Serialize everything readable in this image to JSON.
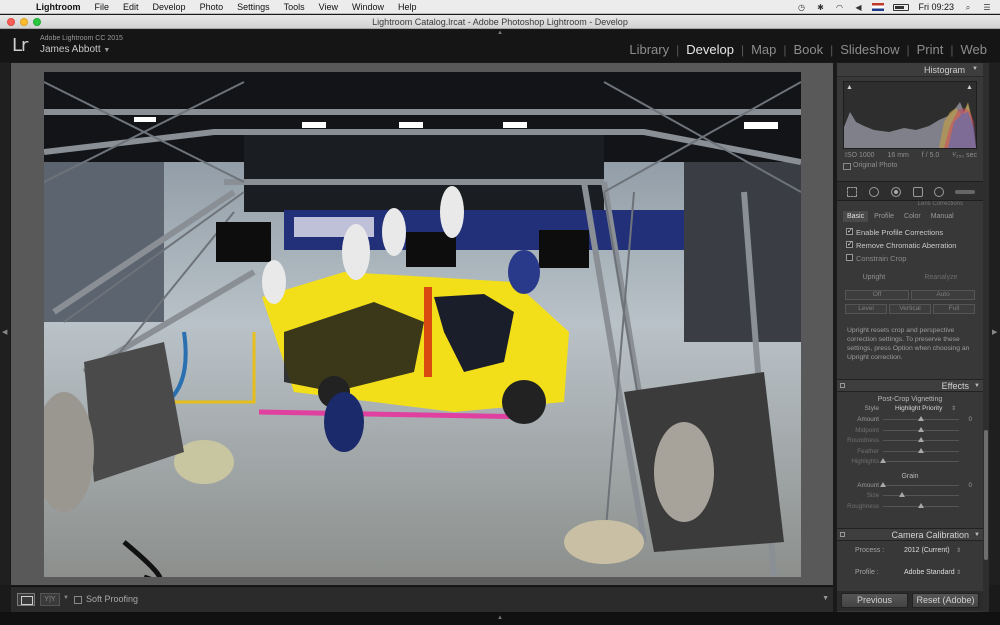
{
  "menubar": {
    "app_name": "Lightroom",
    "items": [
      "File",
      "Edit",
      "Develop",
      "Photo",
      "Settings",
      "Tools",
      "View",
      "Window",
      "Help"
    ],
    "clock": "Fri 09:23"
  },
  "window": {
    "title": "Lightroom Catalog.lrcat - Adobe Photoshop Lightroom - Develop"
  },
  "identity": {
    "logo": "Lr",
    "product": "Adobe Lightroom CC 2015",
    "user": "James Abbott"
  },
  "modules": {
    "items": [
      "Library",
      "Develop",
      "Map",
      "Book",
      "Slideshow",
      "Print",
      "Web"
    ],
    "active": "Develop"
  },
  "histogram": {
    "title": "Histogram",
    "iso": "ISO 1000",
    "focal": "16 mm",
    "aperture": "f / 5.0",
    "shutter": "¹⁄₂₅₀ sec",
    "original_label": "Original Photo"
  },
  "lens": {
    "cut_title": "Lens Corrections",
    "tabs": [
      "Basic",
      "Profile",
      "Color",
      "Manual"
    ],
    "active_tab": "Basic",
    "checkboxes": [
      {
        "label": "Enable Profile Corrections",
        "checked": true
      },
      {
        "label": "Remove Chromatic Aberration",
        "checked": true
      },
      {
        "label": "Constrain Crop",
        "checked": false
      }
    ],
    "upright_label": "Upright",
    "reanalyze_label": "Reanalyze",
    "btns_row1": [
      "Off",
      "Auto"
    ],
    "btns_row2": [
      "Level",
      "Vertical",
      "Full"
    ],
    "description": "Upright resets crop and perspective correction settings. To preserve these settings, press Option when choosing an Upright correction."
  },
  "effects": {
    "title": "Effects",
    "vignette_title": "Post-Crop Vignetting",
    "style_label": "Style",
    "style_value": "Highlight Priority",
    "vignette_sliders": [
      {
        "label": "Amount",
        "value": "0",
        "pos": 0.5
      },
      {
        "label": "Midpoint",
        "value": "",
        "pos": 0.5
      },
      {
        "label": "Roundness",
        "value": "",
        "pos": 0.5
      },
      {
        "label": "Feather",
        "value": "",
        "pos": 0.5
      },
      {
        "label": "Highlights",
        "value": "",
        "pos": 0.0
      }
    ],
    "grain_title": "Grain",
    "grain_sliders": [
      {
        "label": "Amount",
        "value": "0",
        "pos": 0.0
      },
      {
        "label": "Size",
        "value": "",
        "pos": 0.25
      },
      {
        "label": "Roughness",
        "value": "",
        "pos": 0.5
      }
    ]
  },
  "calibration": {
    "title": "Camera Calibration",
    "process_label": "Process :",
    "process_value": "2012 (Current)",
    "profile_label": "Profile :",
    "profile_value": "Adobe Standard"
  },
  "toolbar": {
    "proofing_label": "Soft Proofing",
    "view_mode": "Y|Y"
  },
  "footer": {
    "previous_label": "Previous",
    "reset_label": "Reset (Adobe)"
  }
}
